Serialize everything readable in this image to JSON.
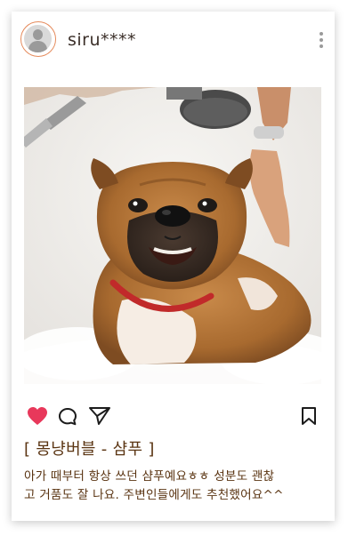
{
  "post": {
    "username": "siru****",
    "title": "[ 몽냥버블 - 샴푸 ]",
    "caption_line1": "아가 때부터 항상 쓰던 샴푸예요ㅎㅎ 성분도 괜찮",
    "caption_line2": "고 거품도 잘 나요. 주변인들에게도 추천했어요^^"
  },
  "colors": {
    "heart": "#e8385b",
    "text_brown": "#5a3412",
    "avatar_ring": "#e58a5b"
  },
  "icons": {
    "avatar": "user-avatar-icon",
    "more": "more-vertical-icon",
    "like": "heart-icon",
    "comment": "comment-icon",
    "share": "send-icon",
    "save": "bookmark-icon"
  }
}
